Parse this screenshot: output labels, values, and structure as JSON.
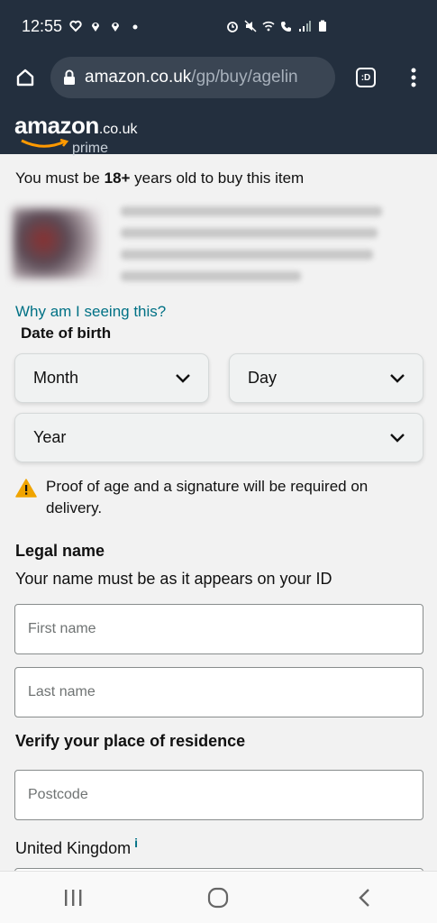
{
  "status_bar": {
    "time": "12:55",
    "icons_left": [
      "heart-icon",
      "location-icon",
      "location-icon",
      "dot-icon"
    ],
    "icons_right": [
      "alarm-icon",
      "mute-icon",
      "wifi-icon",
      "call-icon",
      "signal-icon",
      "battery-icon"
    ]
  },
  "browser": {
    "url_host": "amazon.co.uk",
    "url_path": "/gp/buy/agelin",
    "tab_label": ":D"
  },
  "header": {
    "logo_text": "amazon",
    "logo_suffix": ".co.uk",
    "logo_prime": "prime"
  },
  "content": {
    "age_notice_prefix": "You must be ",
    "age_notice_bold": "18+",
    "age_notice_suffix": " years old to buy this item",
    "why_link": "Why am I seeing this?",
    "dob_label": "Date of birth",
    "month_select": "Month",
    "day_select": "Day",
    "year_select": "Year",
    "warning_text": "Proof of age and a signature will be required on delivery.",
    "legal_heading": "Legal name",
    "legal_sub": "Your name must be as it appears on your ID",
    "first_name_placeholder": "First name",
    "last_name_placeholder": "Last name",
    "verify_heading": "Verify your place of residence",
    "postcode_placeholder": "Postcode",
    "country": "United Kingdom",
    "country_info": "i"
  },
  "colors": {
    "header_bg": "#232f3e",
    "link": "#007185",
    "warning": "#f0a400"
  }
}
